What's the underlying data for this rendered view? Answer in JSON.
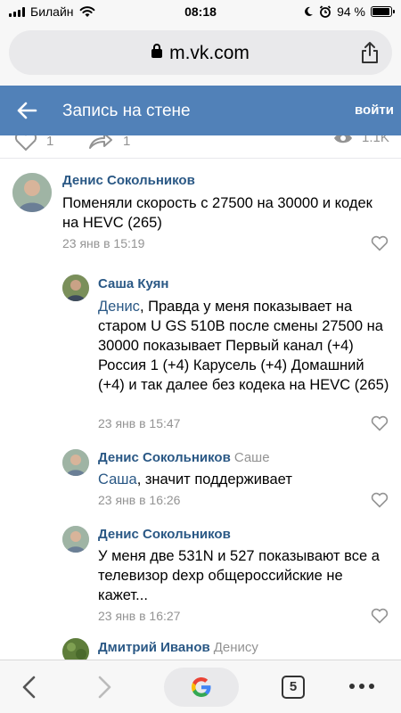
{
  "status": {
    "carrier": "Билайн",
    "time": "08:18",
    "battery": "94 %",
    "battery_level": 0.94
  },
  "browser": {
    "url": "m.vk.com",
    "tab_count": "5"
  },
  "header": {
    "title": "Запись на стене",
    "login": "войти",
    "bg": "#5181b8"
  },
  "post_actions": {
    "likes": "1",
    "shares": "1",
    "views": "1.1K"
  },
  "comments": [
    {
      "author": "Денис Сокольников",
      "reply_to": "",
      "mention": "",
      "text": "Поменяли скорость с 27500 на 30000 и кодек на HEVC (265)",
      "date": "23 янв в 15:19"
    },
    {
      "author": "Саша Куян",
      "reply_to": "",
      "mention": "Денис",
      "text": ", Правда у меня показывает на старом U GS 510B после смены 27500 на 30000 показывает Первый канал (+4) Россия 1 (+4) Карусель (+4) Домашний (+4) и так далее без кодека на HEVC (265)",
      "date": "23 янв в 15:47"
    },
    {
      "author": "Денис Сокольников",
      "reply_to": "Саше",
      "mention": "Саша",
      "text": ", значит поддерживает",
      "date": "23 янв в 16:26"
    },
    {
      "author": "Денис Сокольников",
      "reply_to": "",
      "mention": "",
      "text": "У меня две 531N и 527 показывают все а телевизор dexp общероссийские не кажет...",
      "date": "23 янв в 16:27"
    },
    {
      "author": "Дмитрий Иванов",
      "reply_to": "Денису",
      "mention": "",
      "text": "",
      "date": ""
    }
  ]
}
